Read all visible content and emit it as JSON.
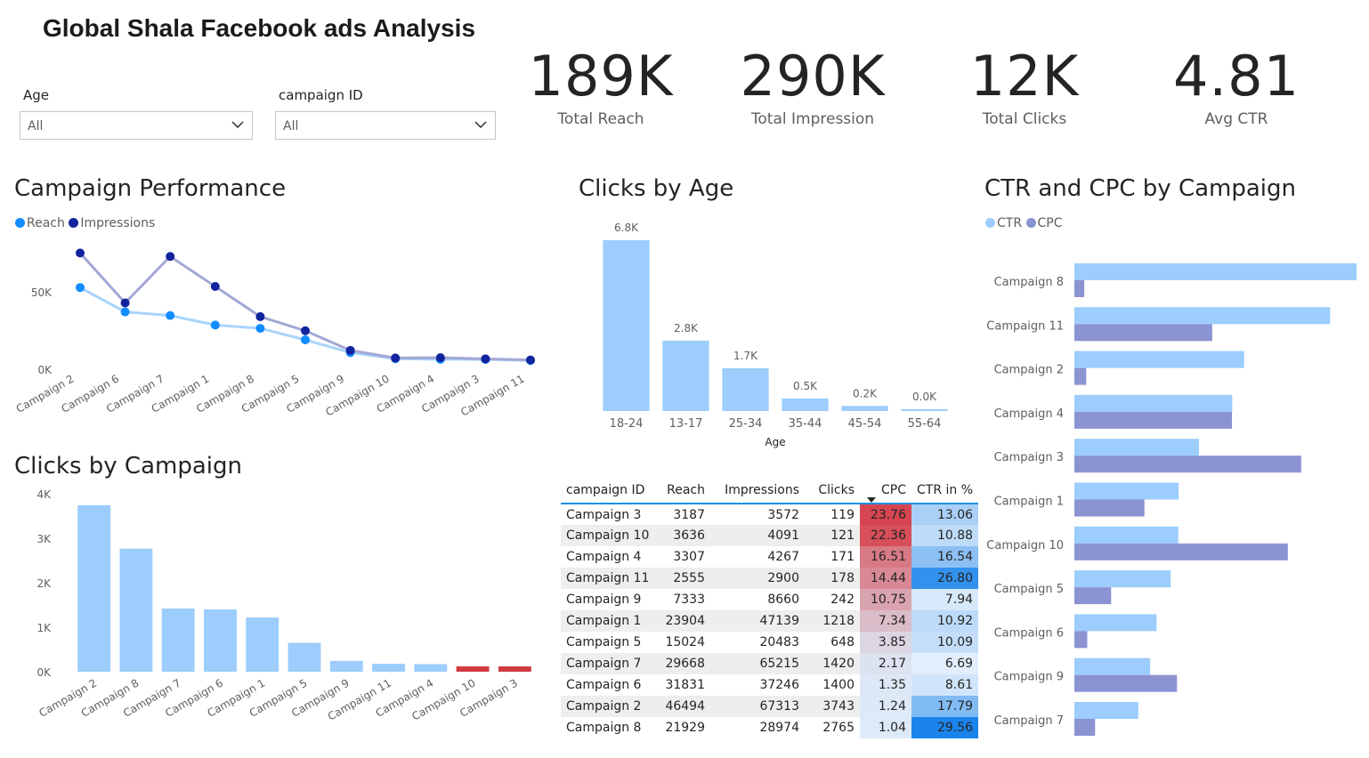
{
  "header": {
    "title": "Global Shala Facebook ads Analysis"
  },
  "filters": [
    {
      "label": "Age",
      "value": "All"
    },
    {
      "label": "campaign ID",
      "value": "All"
    }
  ],
  "kpis": [
    {
      "value": "189K",
      "label": "Total Reach"
    },
    {
      "value": "290K",
      "label": "Total Impression"
    },
    {
      "value": "12K",
      "label": "Total Clicks"
    },
    {
      "value": "4.81",
      "label": "Avg CTR"
    }
  ],
  "colors": {
    "reach": "#118dff",
    "impressions": "#12239e",
    "bar_light": "#9ccdfc",
    "bar_red": "#d13a41",
    "cpc_bar": "#8c93d3"
  },
  "chart_data": [
    {
      "id": "campaign_performance",
      "type": "line",
      "title": "Campaign Performance",
      "categories": [
        "Campaign 2",
        "Campaign 6",
        "Campaign 7",
        "Campaign 1",
        "Campaign 8",
        "Campaign 5",
        "Campaign 9",
        "Campaign 10",
        "Campaign 4",
        "Campaign 3",
        "Campaign 11"
      ],
      "series": [
        {
          "name": "Reach",
          "values": [
            46494,
            31831,
            29668,
            23904,
            21929,
            15024,
            7333,
            3636,
            3307,
            3187,
            2555
          ]
        },
        {
          "name": "Impressions",
          "values": [
            67313,
            37246,
            65215,
            47139,
            28974,
            20483,
            8660,
            4091,
            4267,
            3572,
            2900
          ]
        }
      ],
      "yticks": [
        "50K",
        "0K"
      ],
      "ylim": [
        0,
        75000
      ]
    },
    {
      "id": "clicks_by_campaign",
      "type": "bar",
      "title": "Clicks by Campaign",
      "categories": [
        "Campaign 2",
        "Campaign 8",
        "Campaign 7",
        "Campaign 6",
        "Campaign 1",
        "Campaign 5",
        "Campaign 9",
        "Campaign 11",
        "Campaign 4",
        "Campaign 10",
        "Campaign 3"
      ],
      "values": [
        3743,
        2765,
        1420,
        1400,
        1218,
        648,
        242,
        178,
        171,
        121,
        119
      ],
      "highlight": [
        false,
        false,
        false,
        false,
        false,
        false,
        false,
        false,
        false,
        true,
        true
      ],
      "yticks": [
        "4K",
        "3K",
        "2K",
        "1K",
        "0K"
      ],
      "ylim": [
        0,
        4000
      ]
    },
    {
      "id": "clicks_by_age",
      "type": "bar",
      "title": "Clicks by Age",
      "xlabel": "Age",
      "categories": [
        "18-24",
        "13-17",
        "25-34",
        "35-44",
        "45-54",
        "55-64"
      ],
      "values": [
        6800,
        2800,
        1700,
        500,
        200,
        30
      ],
      "data_labels": [
        "6.8K",
        "2.8K",
        "1.7K",
        "0.5K",
        "0.2K",
        "0.0K"
      ],
      "ylim": [
        0,
        6800
      ]
    },
    {
      "id": "ctr_cpc_by_campaign",
      "type": "bar",
      "orientation": "horizontal",
      "title": "CTR and CPC by Campaign",
      "categories": [
        "Campaign 8",
        "Campaign 11",
        "Campaign 2",
        "Campaign 4",
        "Campaign 3",
        "Campaign 1",
        "Campaign 10",
        "Campaign 5",
        "Campaign 6",
        "Campaign 9",
        "Campaign 7"
      ],
      "series": [
        {
          "name": "CTR",
          "values": [
            29.56,
            26.8,
            17.79,
            16.54,
            13.06,
            10.92,
            10.88,
            10.09,
            8.61,
            7.94,
            6.69
          ]
        },
        {
          "name": "CPC",
          "values": [
            1.04,
            14.44,
            1.24,
            16.51,
            23.76,
            7.34,
            22.36,
            3.85,
            1.35,
            10.75,
            2.17
          ]
        }
      ],
      "xlim": [
        0,
        29.56
      ]
    },
    {
      "id": "campaign_table",
      "type": "table",
      "columns": [
        "campaign ID",
        "Reach",
        "Impressions",
        "Clicks",
        "CPC",
        "CTR in %"
      ],
      "sorted_column": "CPC",
      "rows": [
        [
          "Campaign 3",
          "3187",
          "3572",
          "119",
          "23.76",
          "13.06"
        ],
        [
          "Campaign 10",
          "3636",
          "4091",
          "121",
          "22.36",
          "10.88"
        ],
        [
          "Campaign 4",
          "3307",
          "4267",
          "171",
          "16.51",
          "16.54"
        ],
        [
          "Campaign 11",
          "2555",
          "2900",
          "178",
          "14.44",
          "26.80"
        ],
        [
          "Campaign 9",
          "7333",
          "8660",
          "242",
          "10.75",
          "7.94"
        ],
        [
          "Campaign 1",
          "23904",
          "47139",
          "1218",
          "7.34",
          "10.92"
        ],
        [
          "Campaign 5",
          "15024",
          "20483",
          "648",
          "3.85",
          "10.09"
        ],
        [
          "Campaign 7",
          "29668",
          "65215",
          "1420",
          "2.17",
          "6.69"
        ],
        [
          "Campaign 6",
          "31831",
          "37246",
          "1400",
          "1.35",
          "8.61"
        ],
        [
          "Campaign 2",
          "46494",
          "67313",
          "3743",
          "1.24",
          "17.79"
        ],
        [
          "Campaign 8",
          "21929",
          "28974",
          "2765",
          "1.04",
          "29.56"
        ]
      ]
    }
  ]
}
